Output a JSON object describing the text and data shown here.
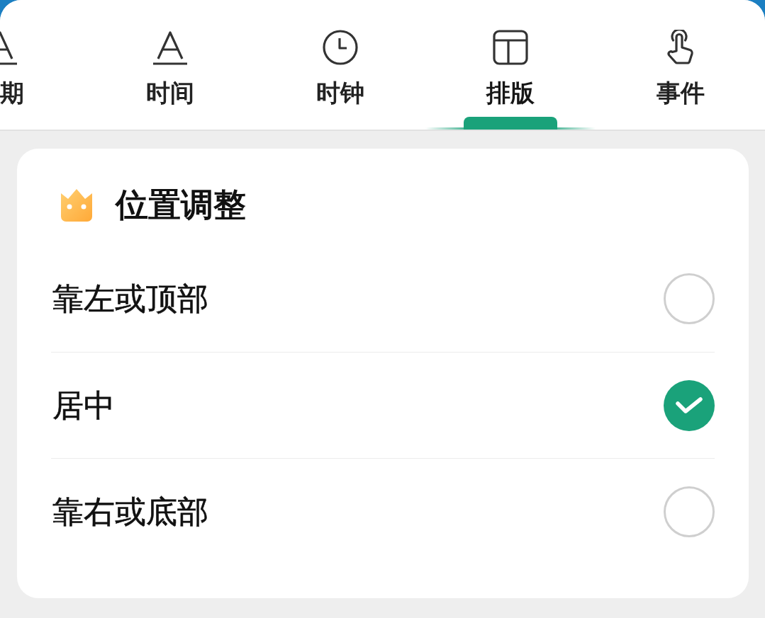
{
  "tabs": [
    {
      "label": "期",
      "kind": "cut",
      "selected": false
    },
    {
      "label": "时间",
      "kind": "full",
      "selected": false
    },
    {
      "label": "时钟",
      "kind": "full",
      "selected": false
    },
    {
      "label": "排版",
      "kind": "full",
      "selected": true
    },
    {
      "label": "事件",
      "kind": "full",
      "selected": false
    }
  ],
  "section": {
    "title": "位置调整",
    "options": [
      {
        "label": "靠左或顶部",
        "selected": false
      },
      {
        "label": "居中",
        "selected": true
      },
      {
        "label": "靠右或底部",
        "selected": false
      }
    ]
  }
}
